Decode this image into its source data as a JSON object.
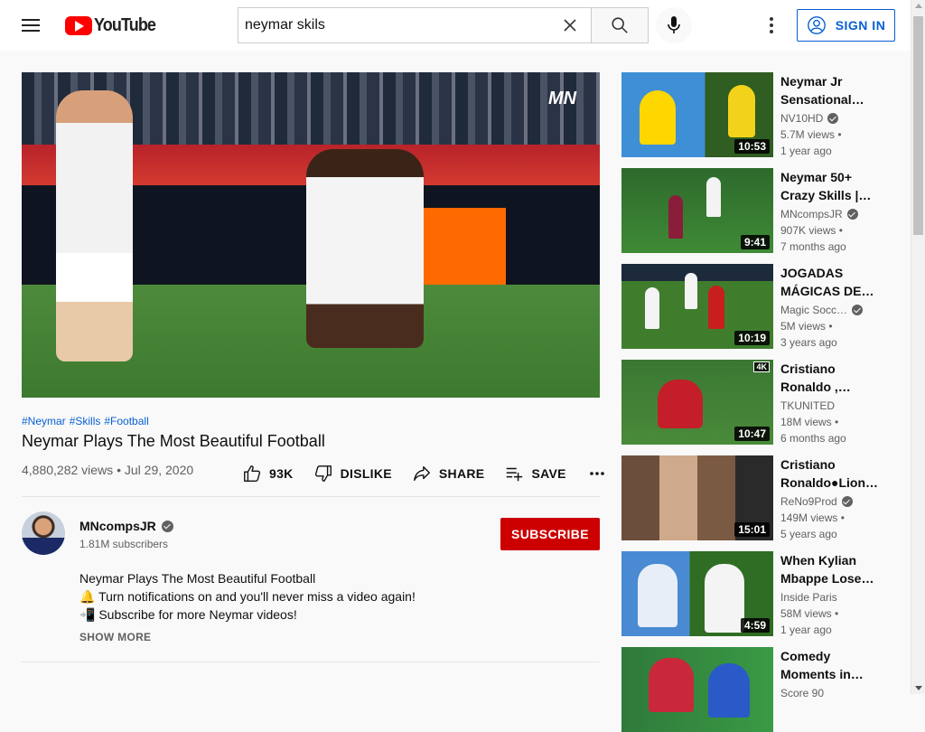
{
  "header": {
    "logo_text": "YouTube",
    "search_value": "neymar skils",
    "signin_label": "SIGN IN"
  },
  "video": {
    "hashtags": [
      "#Neymar",
      "#Skills",
      "#Football"
    ],
    "title": "Neymar Plays The Most Beautiful Football",
    "views": "4,880,282 views",
    "date": "Jul 29, 2020",
    "meta_separator": "•",
    "watermark": "MN",
    "actions": {
      "likes": "93K",
      "dislike": "DISLIKE",
      "share": "SHARE",
      "save": "SAVE"
    }
  },
  "channel": {
    "name": "MNcompsJR",
    "subscribers": "1.81M subscribers",
    "subscribe_label": "SUBSCRIBE"
  },
  "description": {
    "line1": "Neymar Plays The Most Beautiful Football",
    "line2": "🔔 Turn notifications on and you'll never miss a video again!",
    "line3": "📲 Subscribe for more Neymar videos!",
    "show_more": "SHOW MORE"
  },
  "sidebar": [
    {
      "title_l1": "Neymar Jr",
      "title_l2": "Sensational…",
      "channel": "NV10HD",
      "verified": true,
      "views": "5.7M views",
      "age": "1 year ago",
      "duration": "10:53"
    },
    {
      "title_l1": "Neymar 50+",
      "title_l2": "Crazy Skills |…",
      "channel": "MNcompsJR",
      "verified": true,
      "views": "907K views",
      "age": "7 months ago",
      "duration": "9:41"
    },
    {
      "title_l1": "JOGADAS",
      "title_l2": "MÁGICAS DE…",
      "channel": "Magic Socc…",
      "verified": true,
      "views": "5M views",
      "age": "3 years ago",
      "duration": "10:19"
    },
    {
      "title_l1": "Cristiano",
      "title_l2": "Ronaldo ,…",
      "channel": "TKUNITED",
      "verified": false,
      "views": "18M views",
      "age": "6 months ago",
      "duration": "10:47",
      "badge": "4K"
    },
    {
      "title_l1": "Cristiano",
      "title_l2": "Ronaldo●Lion…",
      "channel": "ReNo9Prod",
      "verified": true,
      "views": "149M views",
      "age": "5 years ago",
      "duration": "15:01"
    },
    {
      "title_l1": "When Kylian",
      "title_l2": "Mbappe Lose…",
      "channel": "Inside Paris",
      "verified": false,
      "views": "58M views",
      "age": "1 year ago",
      "duration": "4:59"
    },
    {
      "title_l1": "Comedy",
      "title_l2": "Moments in…",
      "channel": "Score 90",
      "verified": false,
      "views": "",
      "age": "",
      "duration": ""
    }
  ],
  "colors": {
    "brand_red": "#ff0000",
    "subscribe_red": "#cc0000",
    "link_blue": "#065fd4"
  }
}
